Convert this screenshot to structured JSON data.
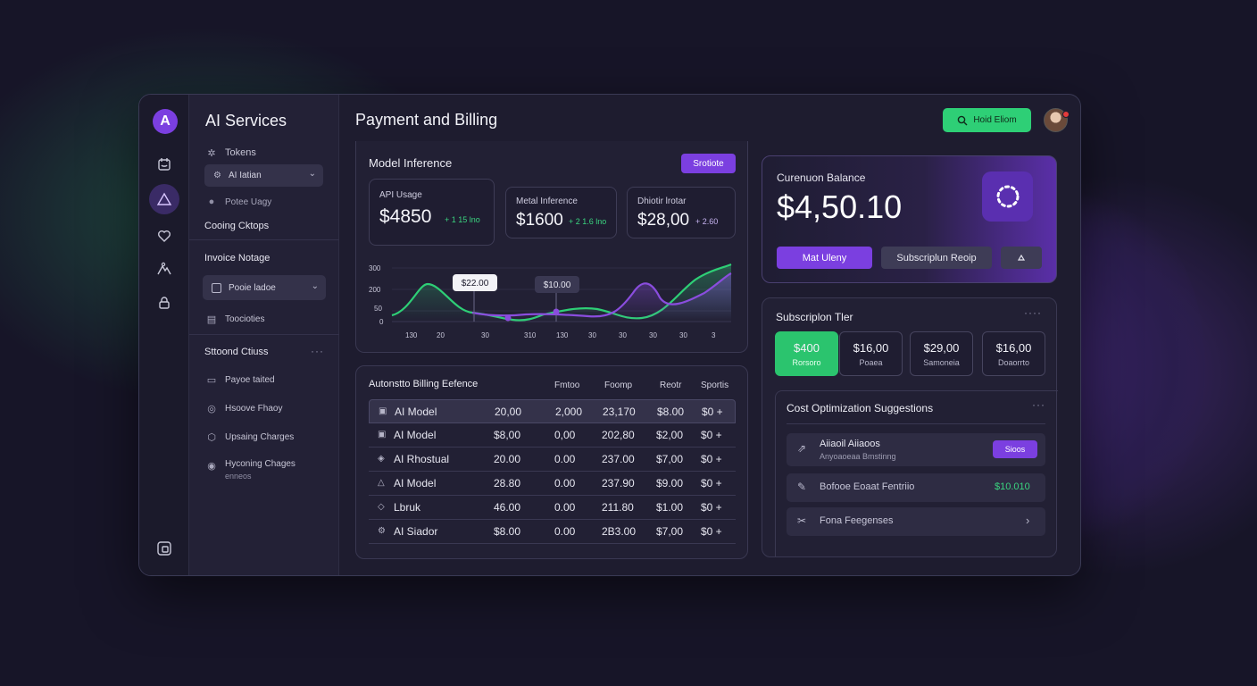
{
  "sidebar": {
    "title": "AI Services",
    "items": [
      {
        "label": "Tokens",
        "icon": "settings-cube-icon"
      },
      {
        "label": "AI Iatian",
        "icon": "model-icon",
        "selected": true
      },
      {
        "label": "Potee Uagy",
        "icon": "dot-icon"
      }
    ],
    "section1": "Cooing Cktops",
    "invoice_heading": "Invoice Notage",
    "invoice_select": "Pooie ladoe",
    "invoice_item": "Toocioties",
    "section2_heading": "Sttoond Ctiuss",
    "section2_items": [
      {
        "label": "Payoe taited",
        "icon": "card-icon"
      },
      {
        "label": "Hsoove Fhaoy",
        "icon": "globe-icon"
      },
      {
        "label": "Upsaing Charges",
        "icon": "cube-icon"
      },
      {
        "label": "Hyconing Chages",
        "sub": "enneos",
        "icon": "circle-icon"
      }
    ]
  },
  "rail_icons": [
    "calendar-icon",
    "triangle-icon",
    "heart-icon",
    "people-icon",
    "lock-icon",
    "export-icon"
  ],
  "header": {
    "title": "Payment and Billing",
    "action_button": "Hoid Eliom"
  },
  "inference": {
    "title": "Model Inference",
    "button": "Srotiote",
    "stats": [
      {
        "label": "API Usage",
        "value": "$4850",
        "delta": "+ 1 15 lno"
      },
      {
        "label": "Metal Inference",
        "value": "$1600",
        "delta": "+ 2 1.6 lno"
      },
      {
        "label": "Dhiotir lrotar",
        "value": "$28,00",
        "delta": "+ 2.60"
      }
    ],
    "chart": {
      "y_ticks": [
        "300",
        "200",
        "50",
        "0"
      ],
      "x_ticks": [
        "130",
        "20",
        "30",
        "310",
        "130",
        "30",
        "30",
        "30",
        "30",
        "3"
      ],
      "tooltip1": "$22.00",
      "tooltip2": "$10.00"
    }
  },
  "table": {
    "title": "Autonstto Billing Eefence",
    "columns": [
      "Fmtoo",
      "Foomp",
      "Reotr",
      "Sportis"
    ],
    "rows": [
      {
        "name": "AI Model",
        "c1": "20,00",
        "c2": "2,000",
        "c3": "23,170",
        "c4": "$8.00",
        "c5": "$0 +"
      },
      {
        "name": "AI Model",
        "c1": "$8,00",
        "c2": "0,00",
        "c3": "202,80",
        "c4": "$2,00",
        "c5": "$0 +"
      },
      {
        "name": "AI Rhostual",
        "c1": "20.00",
        "c2": "0.00",
        "c3": "237.00",
        "c4": "$7,00",
        "c5": "$0 +"
      },
      {
        "name": "AI Model",
        "c1": "28.80",
        "c2": "0.00",
        "c3": "237.90",
        "c4": "$9.00",
        "c5": "$0 +"
      },
      {
        "name": "Lbruk",
        "c1": "46.00",
        "c2": "0.00",
        "c3": "211.80",
        "c4": "$1.00",
        "c5": "$0 +"
      },
      {
        "name": "AI Siador",
        "c1": "$8.00",
        "c2": "0.00",
        "c3": "2B3.00",
        "c4": "$7,00",
        "c5": "$0 +"
      }
    ]
  },
  "balance": {
    "label": "Curenuon Balance",
    "value": "$4,50.10",
    "btn_primary": "Mat Uleny",
    "btn_secondary": "Subscriplun Reoip",
    "btn_icon": "up-arrow-icon"
  },
  "tiers": {
    "title": "Subscriplon Tler",
    "items": [
      {
        "price": "$400",
        "name": "Rorsoro",
        "active": true
      },
      {
        "price": "$16,00",
        "name": "Poaea",
        "active": false
      },
      {
        "price": "$29,00",
        "name": "Samoneia",
        "active": false
      },
      {
        "price": "$16,00",
        "name": "Doaorrto",
        "active": false
      }
    ]
  },
  "suggestions": {
    "title": "Cost Optimization Suggestions",
    "items": [
      {
        "title": "Aiiaoil Aiiaoos",
        "sub": "Anyoaoeaa Bmstinng",
        "action": "Sioos"
      },
      {
        "title": "Bofooe Eoaat Fentriio",
        "value": "$10.010"
      },
      {
        "title": "Fona Feegenses"
      }
    ]
  },
  "colors": {
    "accent_green": "#2ecf76",
    "accent_purple": "#7b3fe0",
    "line_purple": "#8a4dde"
  }
}
